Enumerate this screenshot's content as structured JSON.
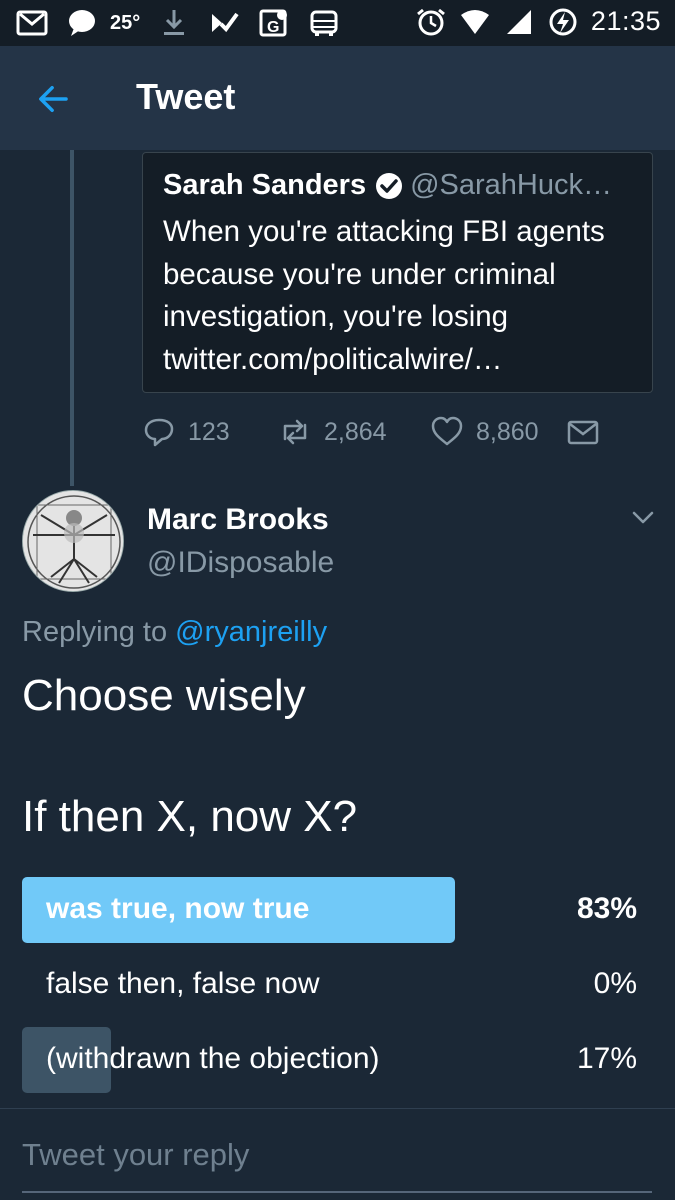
{
  "status_bar": {
    "temperature": "25°",
    "time": "21:35",
    "icons_left": [
      "gmail-icon",
      "message-icon",
      "download-icon",
      "tasks-icon",
      "maps-icon",
      "bus-icon"
    ],
    "icons_right": [
      "alarm-icon",
      "wifi-icon",
      "signal-icon",
      "battery-charging-icon"
    ]
  },
  "app_bar": {
    "title": "Tweet",
    "back_icon": "arrow-left-icon"
  },
  "quoted_tweet": {
    "name": "Sarah Sanders",
    "verified": true,
    "handle": "@SarahHuck…",
    "text": "When you're attacking FBI agents because you're under criminal investigation, you're losing twitter.com/politicalwire/…"
  },
  "actions": {
    "replies": "123",
    "retweets": "2,864",
    "likes": "8,860"
  },
  "reply": {
    "author_name": "Marc Brooks",
    "author_handle": "@IDisposable",
    "replying_prefix": "Replying to",
    "replying_to": "@ryanjreilly",
    "body": "Choose wisely",
    "poll": {
      "question": "If then X, now X?",
      "options": [
        {
          "label": "was true, now true",
          "percent_text": "83%",
          "fraction": 0.83,
          "leading": true
        },
        {
          "label": "false then, false now",
          "percent_text": "0%",
          "fraction": 0.0,
          "leading": false
        },
        {
          "label": "(withdrawn the objection)",
          "percent_text": "17%",
          "fraction": 0.17,
          "leading": false
        }
      ]
    }
  },
  "composer": {
    "placeholder": "Tweet your reply"
  },
  "colors": {
    "background": "#1b2836",
    "app_bar": "#243447",
    "accent": "#1da1f2",
    "poll_leading": "#71c9f8",
    "poll_other": "#3d5466",
    "muted_text": "#8899a6"
  }
}
